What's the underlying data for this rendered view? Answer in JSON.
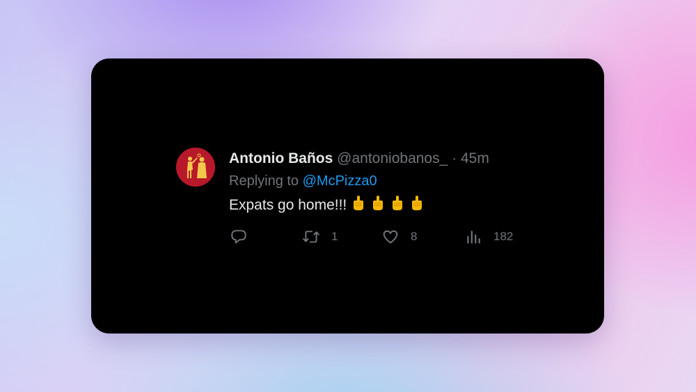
{
  "tweet": {
    "author_name": "Antonio Baños",
    "handle": "@antoniobanos_",
    "separator": "·",
    "time": "45m",
    "replying_prefix": "Replying to",
    "replying_to": "@McPizza0",
    "text": "Expats go home!!!",
    "emojis": [
      "middle-finger-emoji",
      "middle-finger-emoji",
      "middle-finger-emoji",
      "middle-finger-emoji"
    ],
    "avatar_colors": {
      "background": "#b8192a",
      "figures": "#f2c84b"
    }
  },
  "actions": {
    "reply": {
      "icon": "reply-icon",
      "count": ""
    },
    "retweet": {
      "icon": "retweet-icon",
      "count": "1"
    },
    "like": {
      "icon": "heart-icon",
      "count": "8"
    },
    "views": {
      "icon": "views-icon",
      "count": "182"
    }
  },
  "colors": {
    "card_background": "#000000",
    "name": "#e7e9ea",
    "muted": "#71767b",
    "link": "#1d9bf0"
  }
}
